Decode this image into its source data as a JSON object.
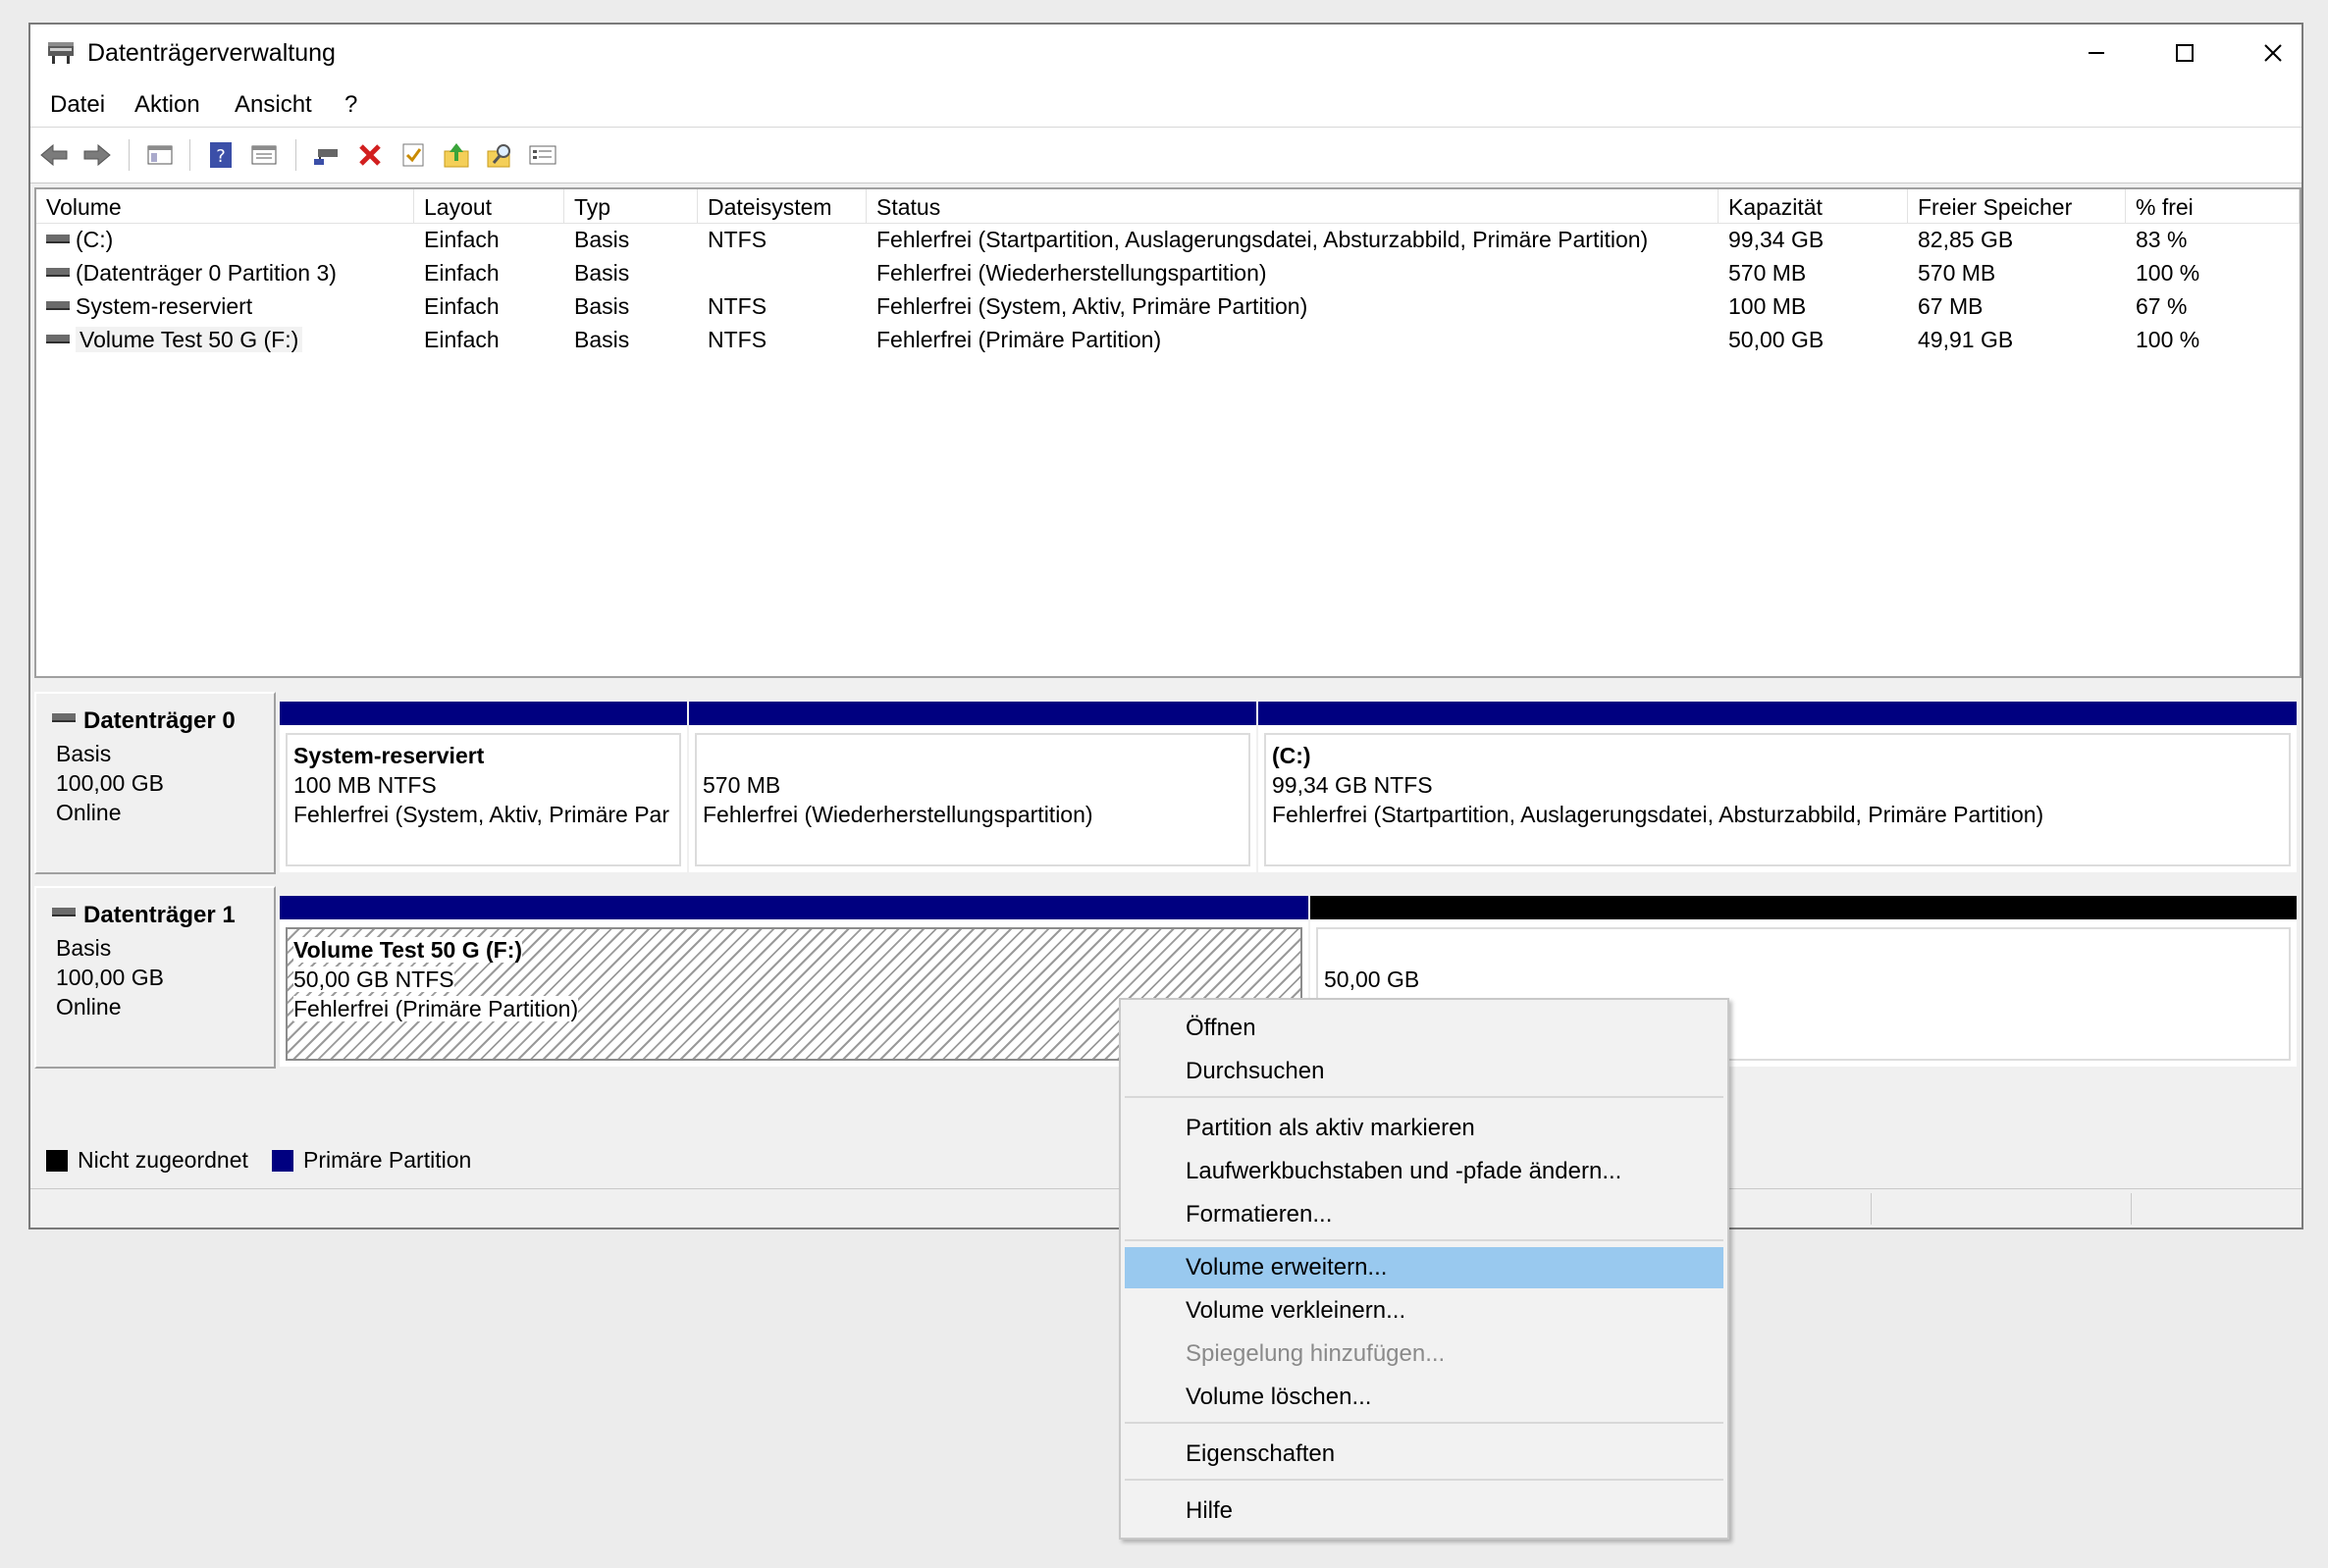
{
  "window": {
    "title": "Datenträgerverwaltung"
  },
  "menu": [
    "Datei",
    "Aktion",
    "Ansicht",
    "?"
  ],
  "toolbar_icons": [
    "back-arrow-icon",
    "forward-arrow-icon",
    "console-tree-icon",
    "help-icon",
    "properties-view-icon",
    "connect-disk-icon",
    "delete-icon",
    "check-icon",
    "folder-up-icon",
    "search-folder-icon",
    "settings-list-icon"
  ],
  "volume_list": {
    "columns": [
      "Volume",
      "Layout",
      "Typ",
      "Dateisystem",
      "Status",
      "Kapazität",
      "Freier Speicher",
      "% frei"
    ],
    "rows": [
      [
        "(C:)",
        "Einfach",
        "Basis",
        "NTFS",
        "Fehlerfrei (Startpartition, Auslagerungsdatei, Absturzabbild, Primäre Partition)",
        "99,34 GB",
        "82,85 GB",
        "83 %"
      ],
      [
        "(Datenträger 0 Partition 3)",
        "Einfach",
        "Basis",
        "",
        "Fehlerfrei (Wiederherstellungspartition)",
        "570 MB",
        "570 MB",
        "100 %"
      ],
      [
        "System-reserviert",
        "Einfach",
        "Basis",
        "NTFS",
        "Fehlerfrei (System, Aktiv, Primäre Partition)",
        "100 MB",
        "67 MB",
        "67 %"
      ],
      [
        "Volume Test 50 G (F:)",
        "Einfach",
        "Basis",
        "NTFS",
        "Fehlerfrei (Primäre Partition)",
        "50,00 GB",
        "49,91 GB",
        "100 %"
      ]
    ]
  },
  "disks": [
    {
      "name": "Datenträger 0",
      "type": "Basis",
      "size": "100,00 GB",
      "state": "Online",
      "partitions": [
        {
          "name": "System-reserviert",
          "size": "100 MB NTFS",
          "status": "Fehlerfrei (System, Aktiv, Primäre Par"
        },
        {
          "name": "",
          "size": "570 MB",
          "status": "Fehlerfrei (Wiederherstellungspartition)"
        },
        {
          "name": "(C:)",
          "size": "99,34 GB NTFS",
          "status": "Fehlerfrei (Startpartition, Auslagerungsdatei, Absturzabbild, Primäre Partition)"
        }
      ]
    },
    {
      "name": "Datenträger 1",
      "type": "Basis",
      "size": "100,00 GB",
      "state": "Online",
      "partitions": [
        {
          "name": "Volume Test 50 G  (F:)",
          "size": "50,00 GB NTFS",
          "status": "Fehlerfrei (Primäre Partition)"
        },
        {
          "name": "",
          "size": "50,00 GB",
          "status": ""
        }
      ]
    }
  ],
  "legend": [
    {
      "label": "Nicht zugeordnet",
      "color": "#000000"
    },
    {
      "label": "Primäre Partition",
      "color": "#000080"
    }
  ],
  "context_menu": {
    "items": [
      {
        "label": "Öffnen",
        "state": "normal"
      },
      {
        "label": "Durchsuchen",
        "state": "normal"
      },
      {
        "label": "Partition als aktiv markieren",
        "state": "normal"
      },
      {
        "label": "Laufwerkbuchstaben und -pfade ändern...",
        "state": "normal"
      },
      {
        "label": "Formatieren...",
        "state": "normal"
      },
      {
        "label": "Volume erweitern...",
        "state": "highlighted"
      },
      {
        "label": "Volume verkleinern...",
        "state": "normal"
      },
      {
        "label": "Spiegelung hinzufügen...",
        "state": "disabled"
      },
      {
        "label": "Volume löschen...",
        "state": "normal"
      },
      {
        "label": "Eigenschaften",
        "state": "normal"
      },
      {
        "label": "Hilfe",
        "state": "normal"
      }
    ]
  },
  "colors": {
    "primary_partition": "#000080",
    "unallocated": "#000000",
    "highlight": "#99c9ef"
  }
}
